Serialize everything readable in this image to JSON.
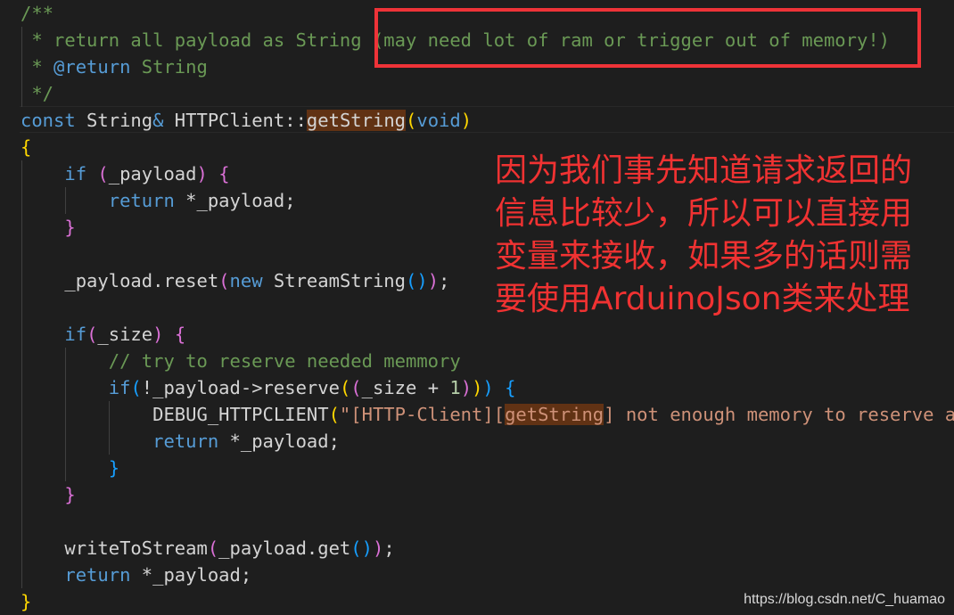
{
  "colors": {
    "comment": "#6a9955",
    "keyword": "#569cd6",
    "text": "#d4d4d4",
    "string": "#ce9178",
    "number": "#b5cea8",
    "bracket1": "#ffd700",
    "bracket2": "#da70d6",
    "bracket3": "#179fff",
    "highlight": "#613214",
    "annotation": "#f03232"
  },
  "code_lines": [
    [
      [
        "/**",
        "comment"
      ]
    ],
    [
      [
        " * return all payload as String (may need lot of ram or trigger out of memory!)",
        "comment"
      ]
    ],
    [
      [
        " * ",
        "comment"
      ],
      [
        "@return",
        "kw"
      ],
      [
        " String",
        "comment"
      ]
    ],
    [
      [
        " */",
        "comment"
      ]
    ],
    [
      [
        "const",
        "kw"
      ],
      [
        " String",
        "txt"
      ],
      [
        "&",
        "kw"
      ],
      [
        " HTTPClient::",
        "txt"
      ],
      [
        "getString",
        "txt",
        "hl"
      ],
      [
        "(",
        "b1"
      ],
      [
        "void",
        "kw"
      ],
      [
        ")",
        "b1"
      ]
    ],
    [
      [
        "{",
        "b1"
      ]
    ],
    [
      [
        "    ",
        "txt"
      ],
      [
        "if",
        "kw"
      ],
      [
        " ",
        "txt"
      ],
      [
        "(",
        "b2"
      ],
      [
        "_payload",
        "txt"
      ],
      [
        ")",
        "b2"
      ],
      [
        " ",
        "txt"
      ],
      [
        "{",
        "b2"
      ]
    ],
    [
      [
        "        ",
        "txt"
      ],
      [
        "return",
        "kw"
      ],
      [
        " *_payload;",
        "txt"
      ]
    ],
    [
      [
        "    ",
        "txt"
      ],
      [
        "}",
        "b2"
      ]
    ],
    [],
    [
      [
        "    _payload.reset",
        "txt"
      ],
      [
        "(",
        "b2"
      ],
      [
        "new",
        "kw"
      ],
      [
        " StreamString",
        "txt"
      ],
      [
        "()",
        "b3"
      ],
      [
        ")",
        "b2"
      ],
      [
        ";",
        "txt"
      ]
    ],
    [],
    [
      [
        "    ",
        "txt"
      ],
      [
        "if",
        "kw"
      ],
      [
        "(",
        "b2"
      ],
      [
        "_size",
        "txt"
      ],
      [
        ")",
        "b2"
      ],
      [
        " ",
        "txt"
      ],
      [
        "{",
        "b2"
      ]
    ],
    [
      [
        "        // try to reserve needed memmory",
        "comment"
      ]
    ],
    [
      [
        "        ",
        "txt"
      ],
      [
        "if",
        "kw"
      ],
      [
        "(",
        "b3"
      ],
      [
        "!_payload->reserve",
        "txt"
      ],
      [
        "(",
        "b1"
      ],
      [
        "(",
        "b2"
      ],
      [
        "_size + ",
        "txt"
      ],
      [
        "1",
        "num"
      ],
      [
        ")",
        "b2"
      ],
      [
        ")",
        "b1"
      ],
      [
        ")",
        "b3"
      ],
      [
        " ",
        "txt"
      ],
      [
        "{",
        "b3"
      ]
    ],
    [
      [
        "            DEBUG_HTTPCLIENT",
        "txt"
      ],
      [
        "(",
        "b1"
      ],
      [
        "\"[HTTP-Client][",
        "str"
      ],
      [
        "getString",
        "str",
        "hl"
      ],
      [
        "] not enough memory to reserve a",
        "str"
      ]
    ],
    [
      [
        "            ",
        "txt"
      ],
      [
        "return",
        "kw"
      ],
      [
        " *_payload;",
        "txt"
      ]
    ],
    [
      [
        "        ",
        "txt"
      ],
      [
        "}",
        "b3"
      ]
    ],
    [
      [
        "    ",
        "txt"
      ],
      [
        "}",
        "b2"
      ]
    ],
    [],
    [
      [
        "    writeToStream",
        "txt"
      ],
      [
        "(",
        "b2"
      ],
      [
        "_payload.get",
        "txt"
      ],
      [
        "()",
        "b3"
      ],
      [
        ")",
        "b2"
      ],
      [
        ";",
        "txt"
      ]
    ],
    [
      [
        "    ",
        "txt"
      ],
      [
        "return",
        "kw"
      ],
      [
        " *_payload;",
        "txt"
      ]
    ],
    [
      [
        "}",
        "b1"
      ]
    ]
  ],
  "annotation": {
    "lines": [
      "因为我们事先知道请求返回的",
      "信息比较少，所以可以直接用",
      "变量来接收，如果多的话则需",
      "要使用ArduinoJson类来处理"
    ]
  },
  "watermark": "https://blog.csdn.net/C_huamao"
}
